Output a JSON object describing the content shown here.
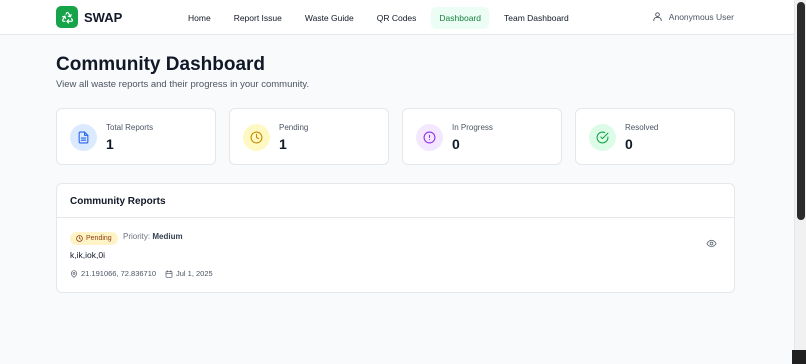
{
  "header": {
    "brand": "SWAP",
    "nav": [
      {
        "label": "Home",
        "active": false
      },
      {
        "label": "Report Issue",
        "active": false
      },
      {
        "label": "Waste Guide",
        "active": false
      },
      {
        "label": "QR Codes",
        "active": false
      },
      {
        "label": "Dashboard",
        "active": true
      },
      {
        "label": "Team Dashboard",
        "active": false
      }
    ],
    "user": "Anonymous User"
  },
  "page": {
    "title": "Community Dashboard",
    "subtitle": "View all waste reports and their progress in your community."
  },
  "stats": [
    {
      "label": "Total Reports",
      "value": "1",
      "icon": "document-icon",
      "color": "#2563eb",
      "bg": "#dbeafe"
    },
    {
      "label": "Pending",
      "value": "1",
      "icon": "clock-icon",
      "color": "#ca8a04",
      "bg": "#fef9c3"
    },
    {
      "label": "In Progress",
      "value": "0",
      "icon": "alert-circle-icon",
      "color": "#9333ea",
      "bg": "#f3e8ff"
    },
    {
      "label": "Resolved",
      "value": "0",
      "icon": "check-circle-icon",
      "color": "#16a34a",
      "bg": "#dcfce7"
    }
  ],
  "reports": {
    "title": "Community Reports",
    "items": [
      {
        "status": "Pending",
        "priority_label": "Priority:",
        "priority_value": "Medium",
        "description": "k,ik,iok,0i",
        "location": "21.191066, 72.836710",
        "date": "Jul 1, 2025"
      }
    ]
  },
  "colors": {
    "brand": "#16a34a",
    "active_nav_bg": "#ecfdf5",
    "pending_badge_bg": "#fef3c7"
  }
}
